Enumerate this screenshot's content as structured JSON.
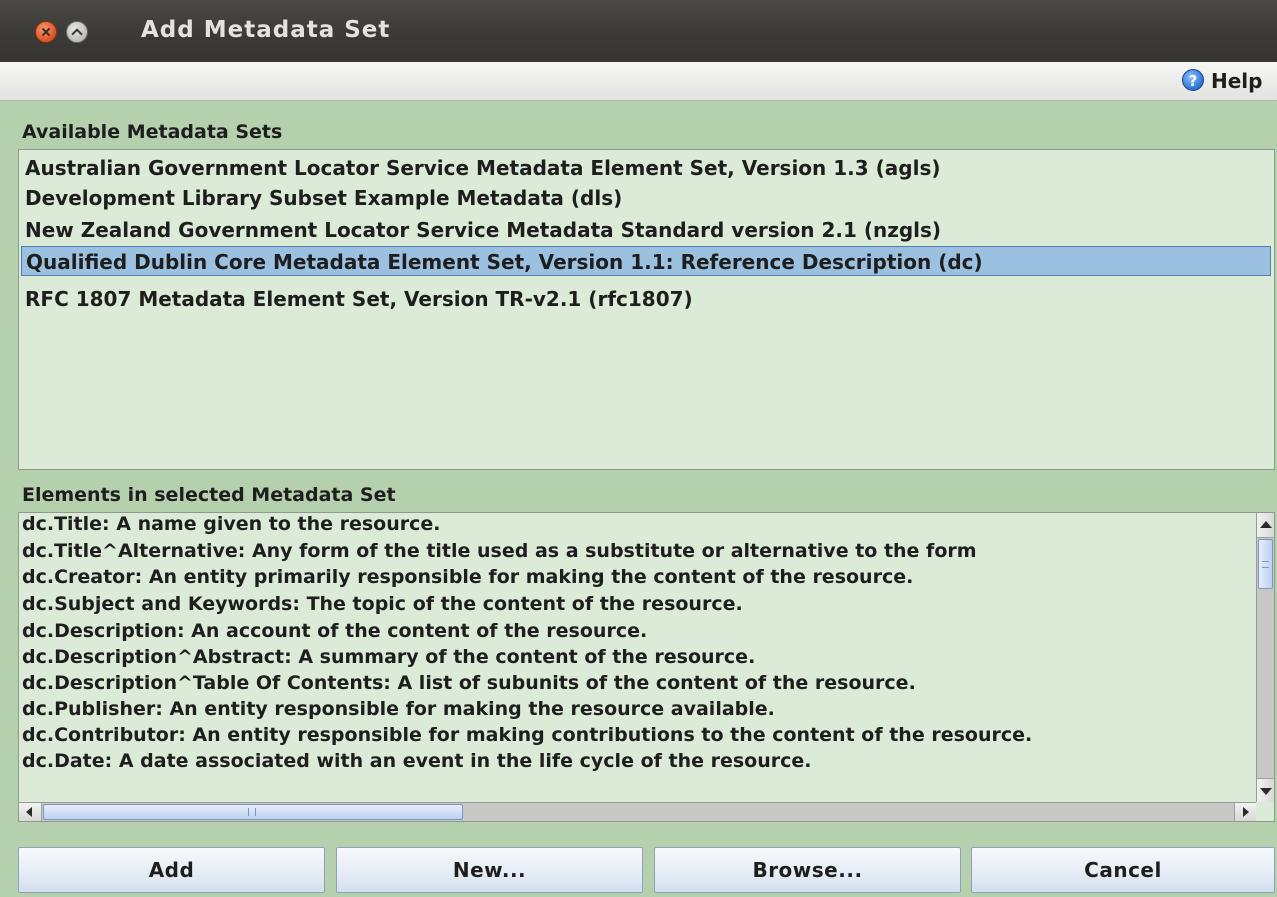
{
  "window": {
    "title": "Add Metadata Set"
  },
  "helpbar": {
    "help_label": "Help",
    "help_icon_glyph": "?"
  },
  "available_sets": {
    "label": "Available Metadata Sets",
    "items": [
      "Australian Government Locator Service Metadata Element Set, Version 1.3 (agls)",
      "Development Library Subset Example Metadata (dls)",
      "New Zealand Government Locator Service Metadata Standard version 2.1 (nzgls)",
      "Qualified Dublin Core Metadata Element Set, Version 1.1: Reference Description (dc)",
      "RFC 1807 Metadata Element Set, Version TR-v2.1 (rfc1807)"
    ],
    "selected_index": 3
  },
  "elements": {
    "label": "Elements in selected Metadata Set",
    "items": [
      "dc.Title: A name given to the resource.",
      "dc.Title^Alternative: Any form of the title used as a substitute or alternative to the form",
      "dc.Creator: An entity primarily responsible for making the content of the resource.",
      "dc.Subject and Keywords: The topic of the content of the resource.",
      "dc.Description: An account of the content of the resource.",
      "dc.Description^Abstract: A summary of the content of the resource.",
      "dc.Description^Table Of Contents: A list of subunits of the content of the resource.",
      "dc.Publisher: An entity responsible for making the resource available.",
      "dc.Contributor: An entity responsible for making contributions to the content of the resource.",
      "dc.Date: A date associated with an event in the life cycle of the resource."
    ]
  },
  "buttons": {
    "add": "Add",
    "new": "New...",
    "browse": "Browse...",
    "cancel": "Cancel"
  },
  "colors": {
    "panel_background": "#b4d0ac",
    "list_background": "#dcebd8",
    "selection": "#9cc0e0",
    "titlebar": "#3c3b37"
  }
}
